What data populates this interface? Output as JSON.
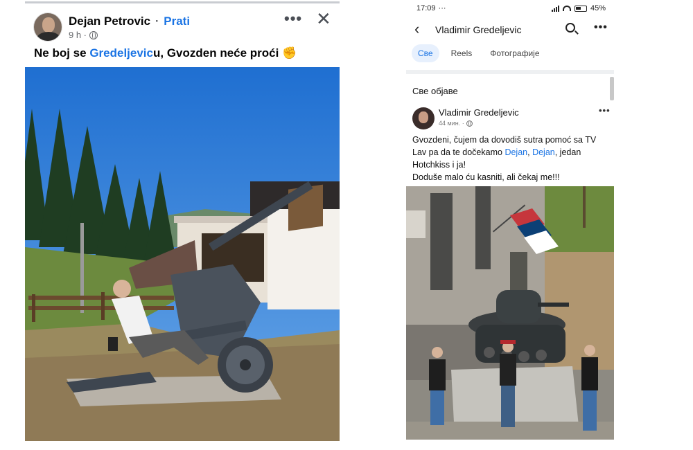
{
  "left_post": {
    "author": "Dejan Petrovic",
    "separator": "·",
    "follow_label": "Prati",
    "time": "9 h ·",
    "more": "•••",
    "close": "✕",
    "caption_pre": "Ne boj se ",
    "caption_mention": "Gredeljevic",
    "caption_post": "u, Gvozden neće proći ✊"
  },
  "phone": {
    "status_time": "17:09",
    "status_dots": "···",
    "battery": "45%",
    "back": "‹",
    "page_title": "Vladimir Gredeljevic",
    "more": "•••",
    "tabs": [
      {
        "label": "Све"
      },
      {
        "label": "Reels"
      },
      {
        "label": "Фотографије"
      }
    ],
    "section_title": "Све објаве",
    "post": {
      "author": "Vladimir Gredeljevic",
      "time": "44 мин. ·",
      "more": "•••",
      "line1": "Gvozdeni, čujem da dovodiš sutra pomoć sa TV",
      "line2_pre": "Lav pa da te dočekamo  ",
      "mention1": "Dejan",
      "comma": ", ",
      "mention2": "Dejan",
      "line2_post": ", jedan",
      "line3": "Hotchkiss i ja!",
      "line4": "Doduše malo ću kasniti, ali čekaj me!!!"
    }
  },
  "colors": {
    "link_blue": "#1b74e4",
    "sky": "#2f7fd8",
    "muted": "#65676b"
  }
}
